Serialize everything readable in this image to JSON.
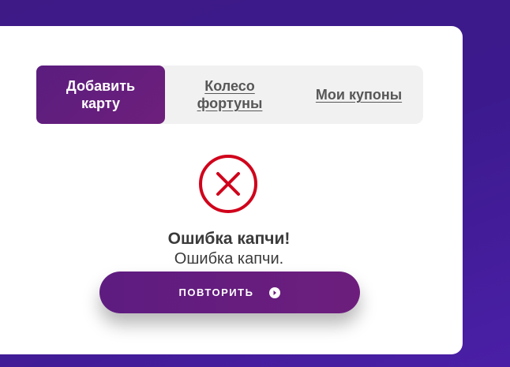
{
  "tabs": [
    {
      "label_line1": "Добавить",
      "label_line2": "карту",
      "active": true
    },
    {
      "label_line1": "Колесо",
      "label_line2": "фортуны",
      "active": false
    },
    {
      "label": "Мои купоны",
      "active": false
    }
  ],
  "error": {
    "icon": "error-x-circle-icon",
    "title": "Ошибка капчи!",
    "message": "Ошибка капчи."
  },
  "retry": {
    "label": "ПОВТОРИТЬ",
    "icon": "arrow-right-circle-icon"
  },
  "colors": {
    "accent": "#6a1e7c",
    "error": "#d0021b",
    "background": "#3d1a8c"
  }
}
